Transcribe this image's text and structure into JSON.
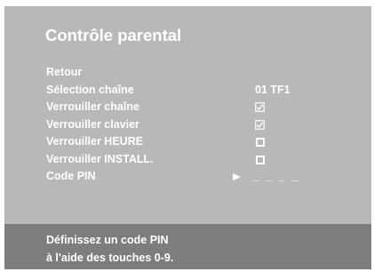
{
  "screen": {
    "title": "Contrôle parental"
  },
  "menu": {
    "items": [
      {
        "label": "Retour"
      },
      {
        "label": "Sélection chaîne",
        "value": "01 TF1"
      },
      {
        "label": "Verrouiller chaîne",
        "checked": true
      },
      {
        "label": "Verrouiller clavier",
        "checked": true
      },
      {
        "label": "Verrouiller HEURE",
        "checked": false
      },
      {
        "label": "Verrouiller INSTALL.",
        "checked": false
      },
      {
        "label": "Code PIN",
        "value": "_ _ _ _",
        "selected": true
      }
    ]
  },
  "footer": {
    "line1": "Définissez un code PIN",
    "line2": "à l'aide des touches 0-9."
  },
  "colors": {
    "background": "#b8b8b8",
    "footer_background": "#7d7d7d",
    "text": "#ffffff"
  },
  "icons": {
    "checked": "checkbox-checked-icon",
    "unchecked": "checkbox-empty-icon",
    "cursor": "selection-arrow-icon"
  }
}
